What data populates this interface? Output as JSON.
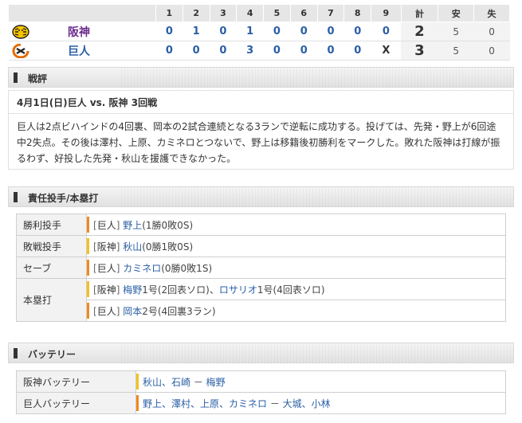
{
  "scoreboard": {
    "innings": [
      "1",
      "2",
      "3",
      "4",
      "5",
      "6",
      "7",
      "8",
      "9"
    ],
    "total_label": "計",
    "hits_label": "安",
    "errors_label": "失",
    "teams": [
      {
        "name": "阪神",
        "scores": [
          "0",
          "1",
          "0",
          "1",
          "0",
          "0",
          "0",
          "0",
          "0"
        ],
        "total": "2",
        "hits": "5",
        "errors": "0"
      },
      {
        "name": "巨人",
        "scores": [
          "0",
          "0",
          "0",
          "3",
          "0",
          "0",
          "0",
          "0",
          "X"
        ],
        "total": "3",
        "hits": "5",
        "errors": "0"
      }
    ]
  },
  "review": {
    "section_title": "戦評",
    "headline": "4月1日(日)巨人 vs. 阪神 3回戦",
    "body": "巨人は2点ビハインドの4回裏、岡本の2試合連続となる3ランで逆転に成功する。投げては、先発・野上が6回途中2失点。その後は澤村、上原、カミネロとつないで、野上は移籍後初勝利をマークした。敗れた阪神は打線が振るわず、好投した先発・秋山を援護できなかった。"
  },
  "pitchers": {
    "section_title": "責任投手/本塁打",
    "win": {
      "label": "勝利投手",
      "team": "巨人",
      "player": "野上",
      "record": "(1勝0敗0S)"
    },
    "loss": {
      "label": "敗戦投手",
      "team": "阪神",
      "player": "秋山",
      "record": "(0勝1敗0S)"
    },
    "save": {
      "label": "セーブ",
      "team": "巨人",
      "player": "カミネロ",
      "record": "(0勝0敗1S)"
    },
    "hr": {
      "label": "本塁打",
      "rows": [
        {
          "team": "阪神",
          "p1": "梅野",
          "d1": "1号(2回表ソロ)、",
          "p2": "ロサリオ",
          "d2": "1号(4回表ソロ)"
        },
        {
          "team": "巨人",
          "p1": "岡本",
          "d1": "2号(4回裏3ラン)"
        }
      ]
    }
  },
  "battery": {
    "section_title": "バッテリー",
    "rows": [
      {
        "label": "阪神バッテリー",
        "pitchers": "秋山、石崎",
        "sep": " － ",
        "catchers": "梅野"
      },
      {
        "label": "巨人バッテリー",
        "pitchers": "野上、澤村、上原、カミネロ",
        "sep": " － ",
        "catchers": "大城、小林"
      }
    ]
  },
  "colors": {
    "hanshin": "#6b2a8c",
    "kyojin": "#2a5ea5",
    "orange": "#ef8a1e",
    "yellow": "#f4c21c"
  }
}
